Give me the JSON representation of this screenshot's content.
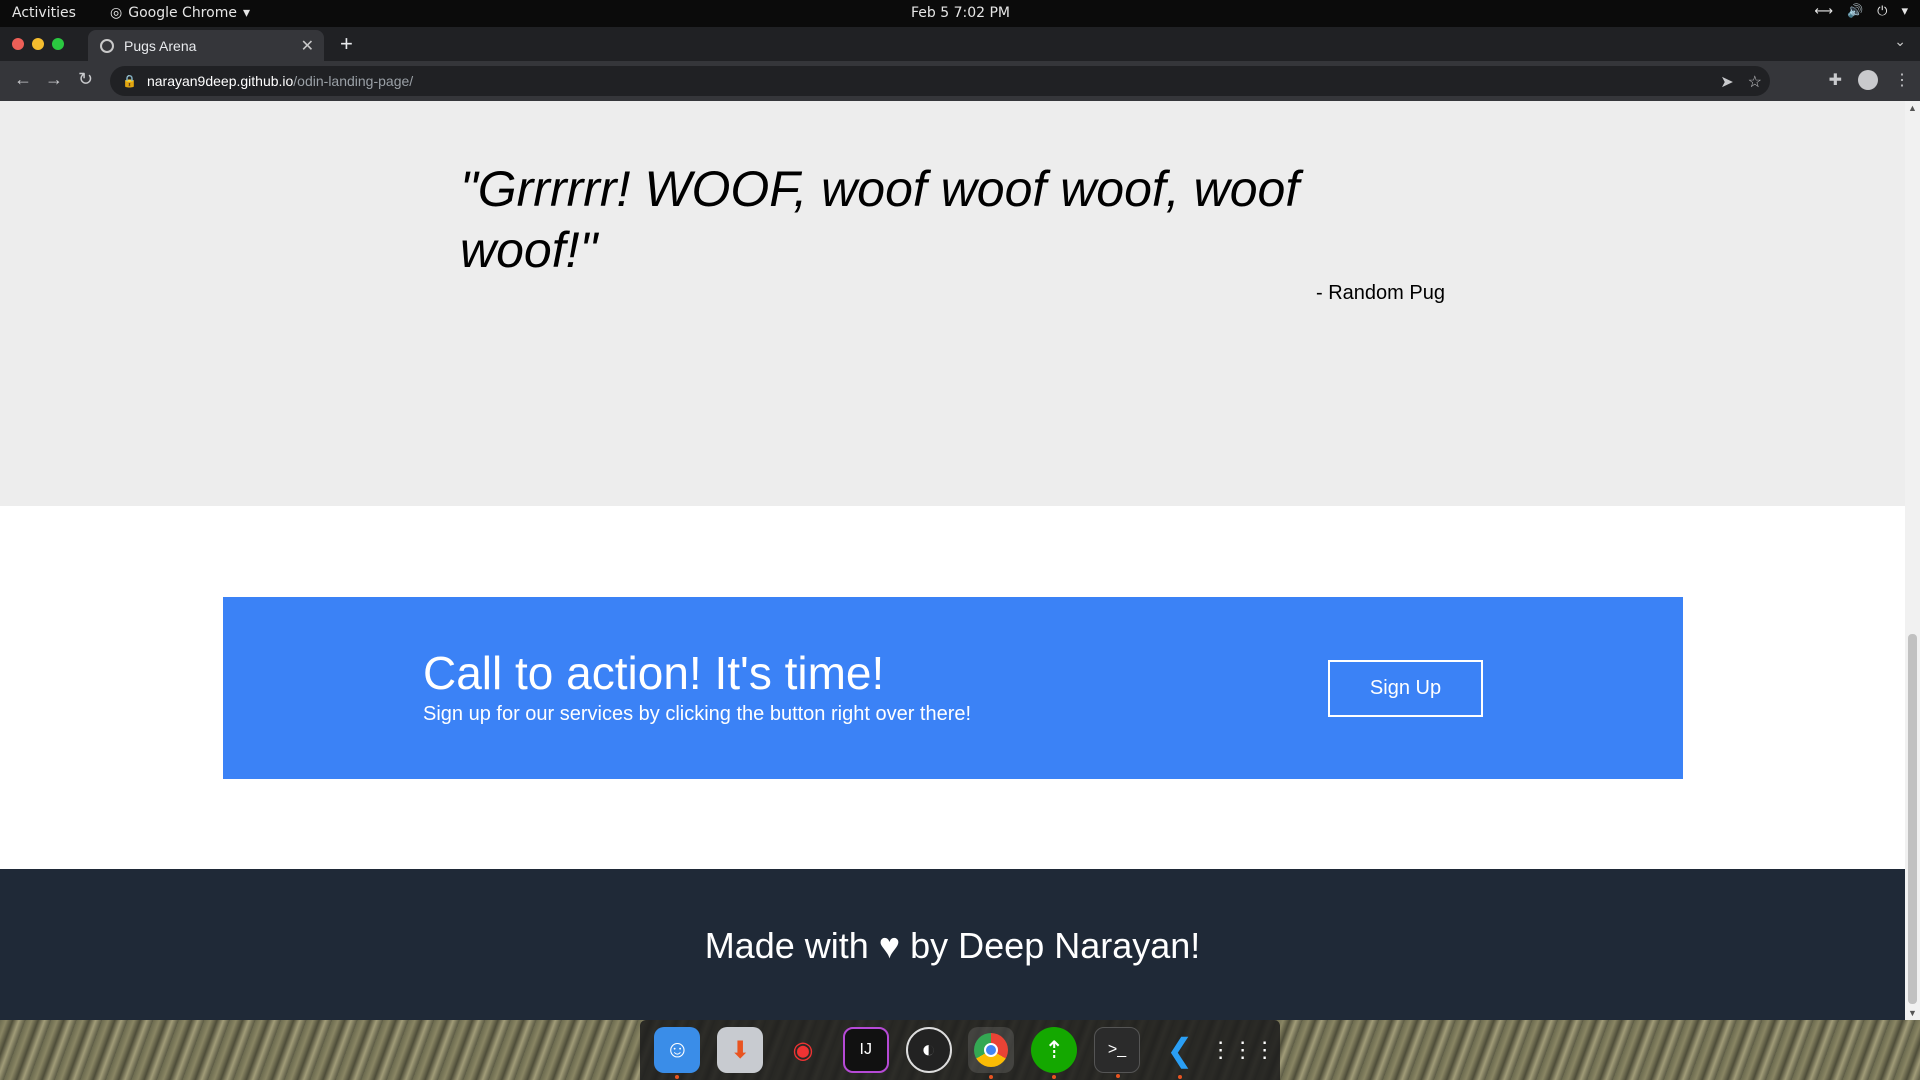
{
  "topbar": {
    "activities": "Activities",
    "app_name": "Google Chrome",
    "clock": "Feb 5  7:02 PM"
  },
  "browser": {
    "tab_title": "Pugs Arena",
    "url_host": "narayan9deep.github.io",
    "url_path": "/odin-landing-page/"
  },
  "page": {
    "quote": "\"Grrrrrr! WOOF, woof woof woof, woof woof!\"",
    "quote_author": "- Random Pug",
    "cta_title": "Call to action! It's time!",
    "cta_subtitle": "Sign up for our services by clicking the button right over there!",
    "cta_button": "Sign Up",
    "footer": "Made with ♥ by Deep Narayan!"
  },
  "colors": {
    "quote_bg": "#ededed",
    "cta_bg": "#3b82f6",
    "footer_bg": "#1f2937"
  },
  "dock": {
    "items": [
      "finder-icon",
      "downloader-icon",
      "help-lifebuoy-icon",
      "intellij-icon",
      "obs-icon",
      "chrome-icon",
      "upwork-icon",
      "terminal-icon",
      "vscode-icon",
      "app-grid-icon"
    ]
  }
}
